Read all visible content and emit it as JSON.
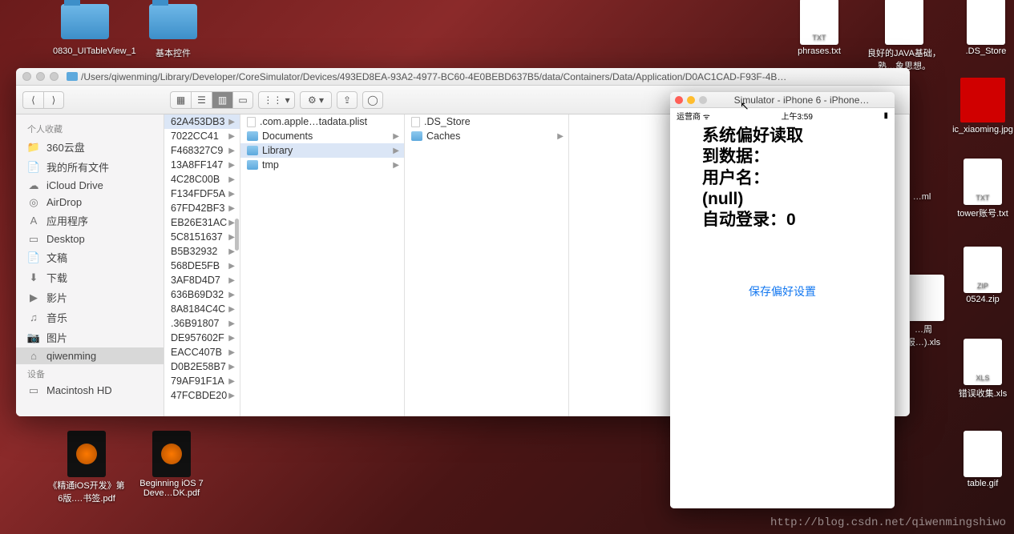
{
  "desktop": {
    "top_left": [
      {
        "label": "0830_UITableView_1",
        "type": "folder"
      },
      {
        "label": "基本控件",
        "type": "folder"
      }
    ],
    "top_right": [
      {
        "label": "phrases.txt",
        "badge": "TXT"
      },
      {
        "label": "良好的JAVA基础，熟…象思想。"
      },
      {
        "label": ".DS_Store"
      }
    ],
    "right": [
      {
        "label": "ic_xiaoming.jpg",
        "type": "img"
      },
      {
        "label": "tower账号.txt",
        "badge": "TXT"
      },
      {
        "label": "…ml"
      },
      {
        "label": "…周报…).xls"
      },
      {
        "label": "0524.zip",
        "badge": "ZIP"
      },
      {
        "label": "错误收集.xls",
        "badge": "XLS"
      },
      {
        "label": "table.gif"
      }
    ],
    "bottom": [
      {
        "label": "《精通iOS开发》第6版.…书签.pdf"
      },
      {
        "label": "Beginning iOS 7 Deve…DK.pdf"
      }
    ]
  },
  "finder": {
    "path": "/Users/qiwenming/Library/Developer/CoreSimulator/Devices/493ED8EA-93A2-4977-BC60-4E0BEBD637B5/data/Containers/Data/Application/D0AC1CAD-F93F-4B…",
    "sidebar": {
      "favorites_header": "个人收藏",
      "favorites": [
        {
          "label": "360云盘",
          "icon": "📁"
        },
        {
          "label": "我的所有文件",
          "icon": "📄"
        },
        {
          "label": "iCloud Drive",
          "icon": "☁"
        },
        {
          "label": "AirDrop",
          "icon": "◎"
        },
        {
          "label": "应用程序",
          "icon": "A"
        },
        {
          "label": "Desktop",
          "icon": "▭"
        },
        {
          "label": "文稿",
          "icon": "📄"
        },
        {
          "label": "下载",
          "icon": "⬇"
        },
        {
          "label": "影片",
          "icon": "▶"
        },
        {
          "label": "音乐",
          "icon": "♫"
        },
        {
          "label": "图片",
          "icon": "📷"
        },
        {
          "label": "qiwenming",
          "icon": "⌂",
          "selected": true
        }
      ],
      "devices_header": "设备",
      "devices": [
        {
          "label": "Macintosh HD",
          "icon": "▭"
        }
      ]
    },
    "columns": {
      "col1": [
        "62A453DB3",
        "7022CC41",
        "F468327C9",
        "13A8FF147",
        "4C28C00B",
        "F134FDF5A",
        "67FD42BF3",
        "EB26E31AC",
        "5C8151637",
        "B5B32932",
        "568DE5FB",
        "3AF8D4D7",
        "636B69D32",
        "8A8184C4C",
        ".36B91807",
        "DE957602F",
        "EACC407B",
        "D0B2E58B7",
        "79AF91F1A",
        "47FCBDE20"
      ],
      "col1_selected": 0,
      "col2": [
        {
          "label": ".com.apple…tadata.plist",
          "type": "file"
        },
        {
          "label": "Documents",
          "type": "folder"
        },
        {
          "label": "Library",
          "type": "folder",
          "selected": true
        },
        {
          "label": "tmp",
          "type": "folder"
        }
      ],
      "col3": [
        {
          "label": ".DS_Store",
          "type": "file"
        },
        {
          "label": "Caches",
          "type": "folder"
        }
      ]
    }
  },
  "simulator": {
    "title": "Simulator - iPhone 6 - iPhone…",
    "carrier": "运营商",
    "wifi": "🗲",
    "time": "上午3:59",
    "body_lines": [
      "系统偏好读取",
      "到数据：",
      "用户名：",
      "(null)",
      "自动登录：0"
    ],
    "link": "保存偏好设置"
  },
  "watermark": "http://blog.csdn.net/qiwenmingshiwo"
}
